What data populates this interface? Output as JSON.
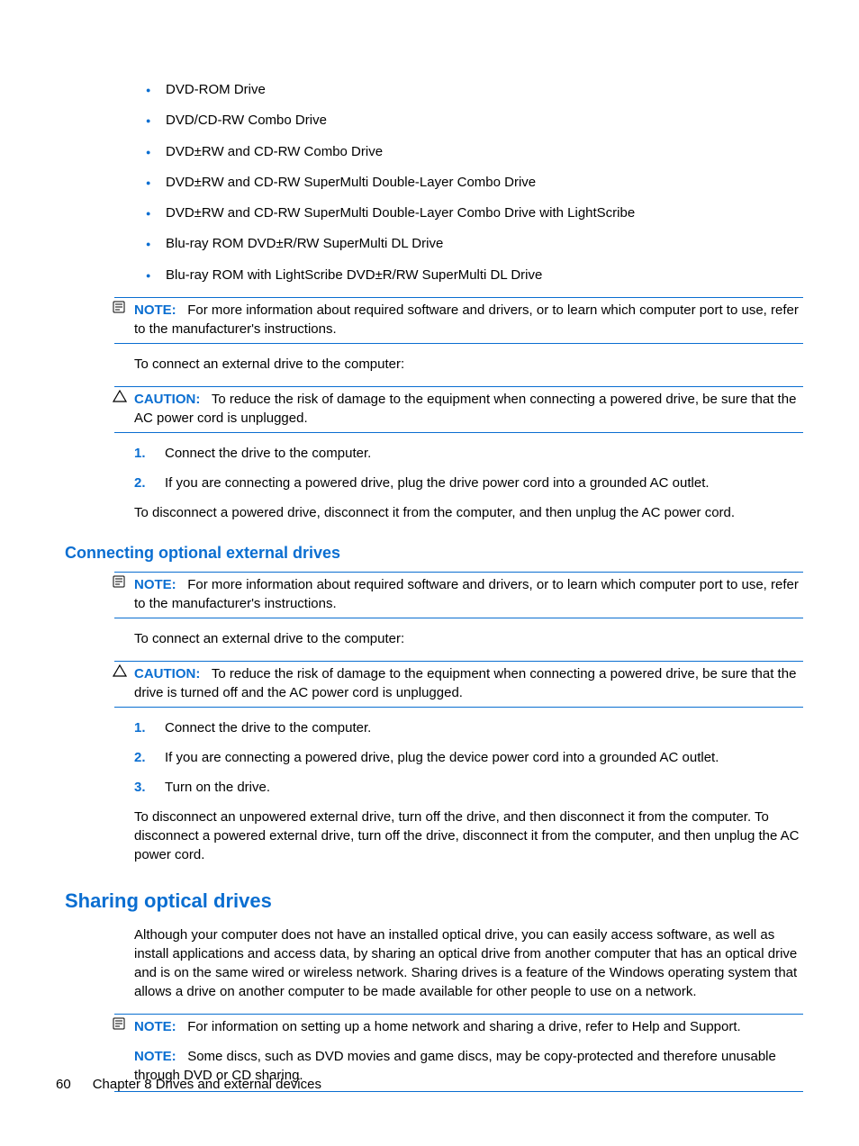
{
  "driveList": [
    "DVD-ROM Drive",
    "DVD/CD-RW Combo Drive",
    "DVD±RW and CD-RW Combo Drive",
    "DVD±RW and CD-RW SuperMulti Double-Layer Combo Drive",
    "DVD±RW and CD-RW SuperMulti Double-Layer Combo Drive with LightScribe",
    "Blu-ray ROM DVD±R/RW SuperMulti DL Drive",
    "Blu-ray ROM with LightScribe DVD±R/RW SuperMulti DL Drive"
  ],
  "note1": {
    "label": "NOTE:",
    "text": "For more information about required software and drivers, or to learn which computer port to use, refer to the manufacturer's instructions."
  },
  "connectIntro1": "To connect an external drive to the computer:",
  "caution1": {
    "label": "CAUTION:",
    "text": "To reduce the risk of damage to the equipment when connecting a powered drive, be sure that the AC power cord is unplugged."
  },
  "steps1": [
    "Connect the drive to the computer.",
    "If you are connecting a powered drive, plug the drive power cord into a grounded AC outlet."
  ],
  "disconnect1": "To disconnect a powered drive, disconnect it from the computer, and then unplug the AC power cord.",
  "heading1": "Connecting optional external drives",
  "note2": {
    "label": "NOTE:",
    "text": "For more information about required software and drivers, or to learn which computer port to use, refer to the manufacturer's instructions."
  },
  "connectIntro2": "To connect an external drive to the computer:",
  "caution2": {
    "label": "CAUTION:",
    "text": "To reduce the risk of damage to the equipment when connecting a powered drive, be sure that the drive is turned off and the AC power cord is unplugged."
  },
  "steps2": [
    "Connect the drive to the computer.",
    "If you are connecting a powered drive, plug the device power cord into a grounded AC outlet.",
    "Turn on the drive."
  ],
  "disconnect2": "To disconnect an unpowered external drive, turn off the drive, and then disconnect it from the computer. To disconnect a powered external drive, turn off the drive, disconnect it from the computer, and then unplug the AC power cord.",
  "heading2": "Sharing optical drives",
  "sharingPara": "Although your computer does not have an installed optical drive, you can easily access software, as well as install applications and access data, by sharing an optical drive from another computer that has an optical drive and is on the same wired or wireless network. Sharing drives is a feature of the Windows operating system that allows a drive on another computer to be made available for other people to use on a network.",
  "note3a": {
    "label": "NOTE:",
    "text": "For information on setting up a home network and sharing a drive, refer to Help and Support."
  },
  "note3b": {
    "label": "NOTE:",
    "text": "Some discs, such as DVD movies and game discs, may be copy-protected and therefore unusable through DVD or CD sharing."
  },
  "footer": {
    "pageNum": "60",
    "chapter": "Chapter 8   Drives and external devices"
  }
}
